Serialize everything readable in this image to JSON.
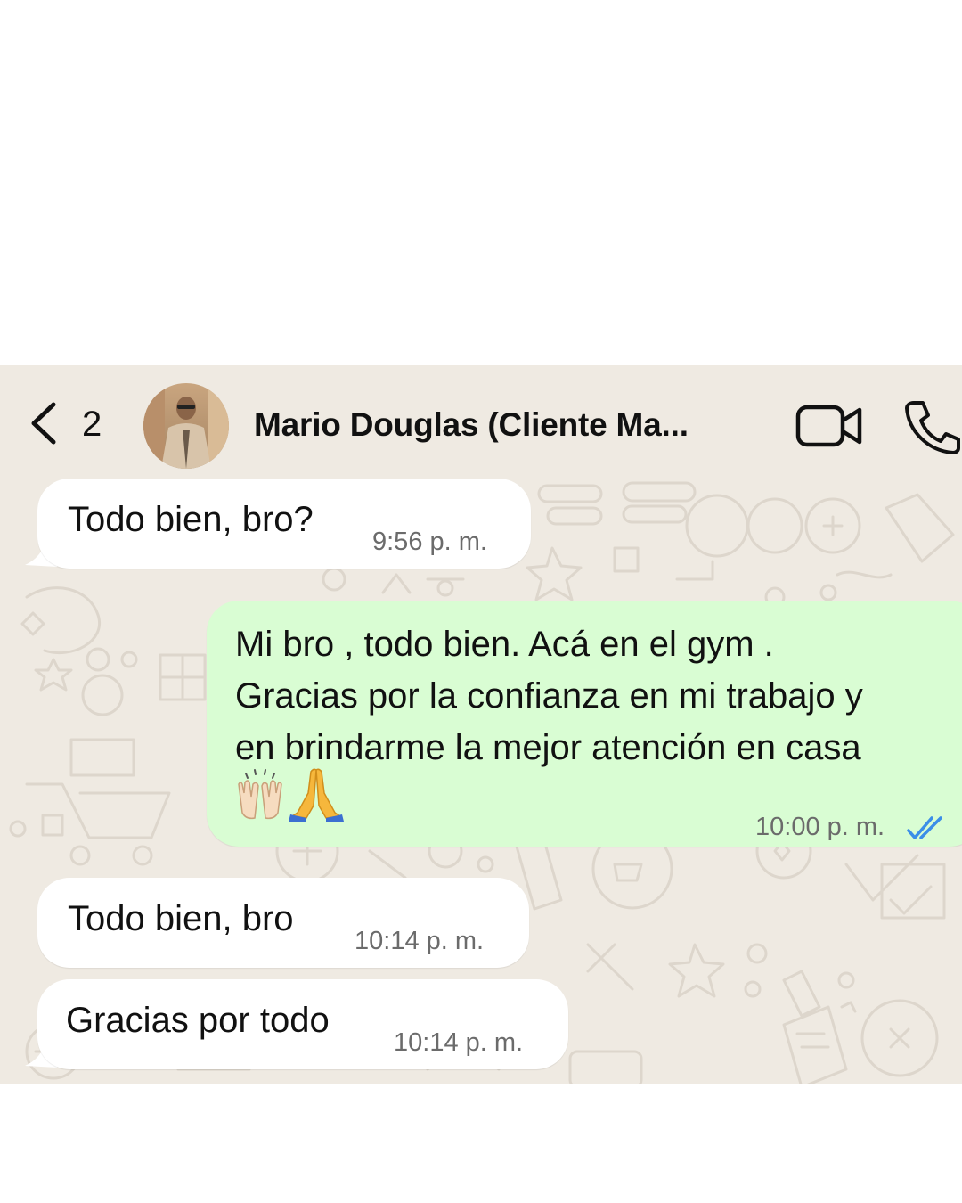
{
  "header": {
    "back_count": "2",
    "contact_name": "Mario Douglas (Cliente Ma..."
  },
  "messages": [
    {
      "direction": "incoming",
      "text": "Todo bien, bro?",
      "time": "9:56 p. m."
    },
    {
      "direction": "outgoing",
      "lines": [
        "Mi bro , todo bien. Acá en el gym  .",
        "Gracias por la confianza en mi trabajo y",
        "en brindarme la mejor atención en casa"
      ],
      "emojis": [
        "raising-hands",
        "folded-hands"
      ],
      "time": "10:00 p. m.",
      "status": "read"
    },
    {
      "direction": "incoming",
      "text": "Todo bien, bro",
      "time": "10:14 p. m."
    },
    {
      "direction": "incoming",
      "text": "Gracias por todo",
      "time": "10:14 p. m."
    }
  ],
  "colors": {
    "incoming_bubble": "#ffffff",
    "outgoing_bubble": "#d9fdd3",
    "chat_background": "#efeae2",
    "read_ticks": "#3b8ee8"
  }
}
